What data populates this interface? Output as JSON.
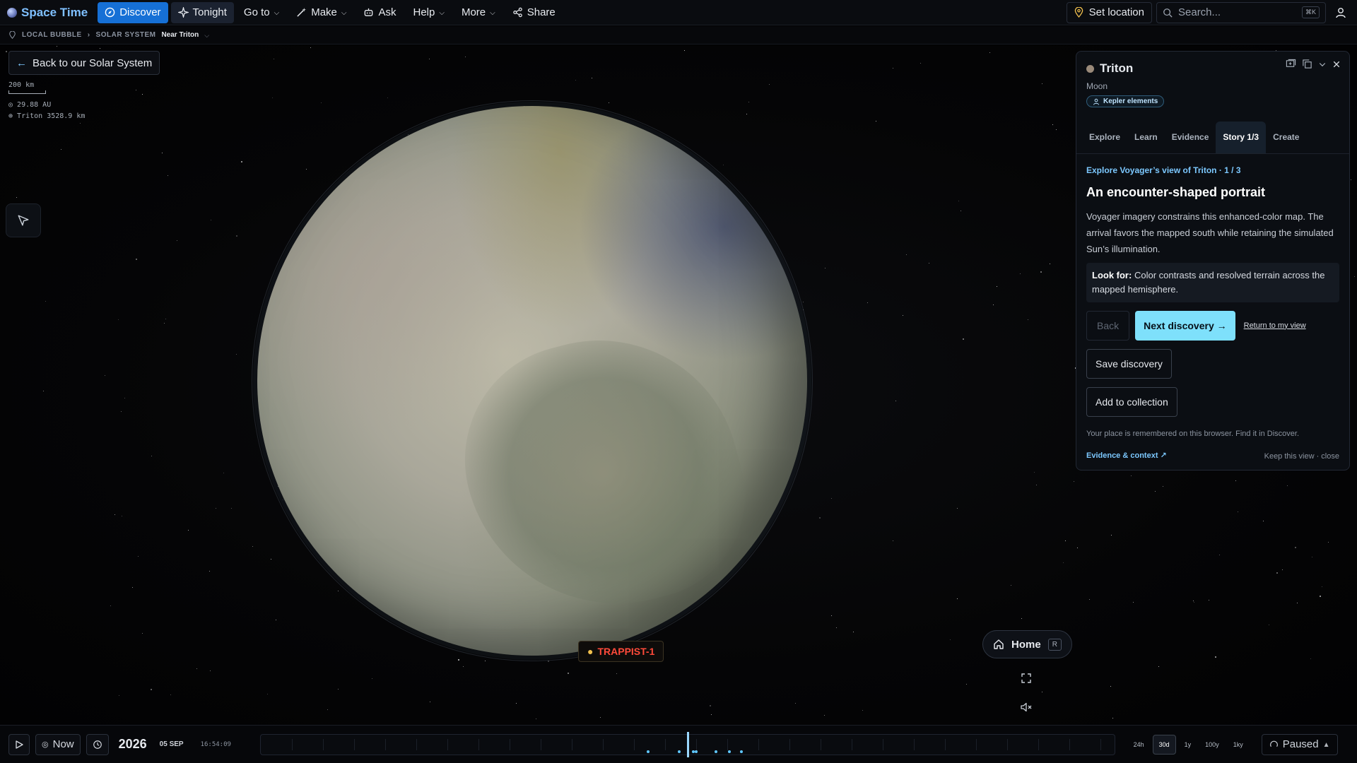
{
  "app": {
    "title": "Space Time"
  },
  "nav": {
    "discover": "Discover",
    "tonight": "Tonight",
    "goto": "Go to",
    "make": "Make",
    "ask": "Ask",
    "help": "Help",
    "more": "More",
    "share": "Share"
  },
  "topright": {
    "set_location": "Set location",
    "search_placeholder": "Search...",
    "search_shortcut": "⌘K"
  },
  "breadcrumb": {
    "items": [
      "LOCAL BUBBLE",
      "SOLAR SYSTEM"
    ],
    "separator": "›",
    "current": "Near Triton"
  },
  "back_button": "Back to our Solar System",
  "readout": {
    "scale": "200 km",
    "distance_sun": "29.88 AU",
    "distance_target": "Triton 3528.9 km"
  },
  "label_marker": "TRAPPIST-1",
  "home_button": {
    "label": "Home",
    "shortcut": "R"
  },
  "panel": {
    "title": "Triton",
    "subtitle": "Moon",
    "badge": "Kepler elements",
    "tabs": [
      "Explore",
      "Learn",
      "Evidence",
      "Story 1/3",
      "Create"
    ],
    "active_tab": "Story 1/3",
    "kicker": "Explore Voyager’s view of Triton · 1 / 3",
    "heading": "An encounter-shaped portrait",
    "body": "Voyager imagery constrains this enhanced-color map. The arrival favors the mapped south while retaining the simulated Sun’s illumination.",
    "lookfor_label": "Look for:",
    "lookfor_text": "Color contrasts and resolved terrain across the mapped hemisphere.",
    "back": "Back",
    "next": "Next discovery →",
    "return": "Return to my view",
    "save": "Save discovery",
    "add_collection": "Add to collection",
    "note": "Your place is remembered on this browser. Find it in Discover.",
    "evidence_link": "Evidence & context ↗",
    "keep": "Keep this view · close"
  },
  "timeline": {
    "now": "Now",
    "year": "2026",
    "date": "05 SEP",
    "time": "16:54:09",
    "ranges": [
      "24h",
      "30d",
      "1y",
      "100y",
      "1ky"
    ],
    "active_range": "30d",
    "status": "Paused"
  },
  "colors": {
    "accent": "#1670d6",
    "cta": "#7ee0fb",
    "marker": "#ff4a3a",
    "link": "#7cc8ff"
  }
}
